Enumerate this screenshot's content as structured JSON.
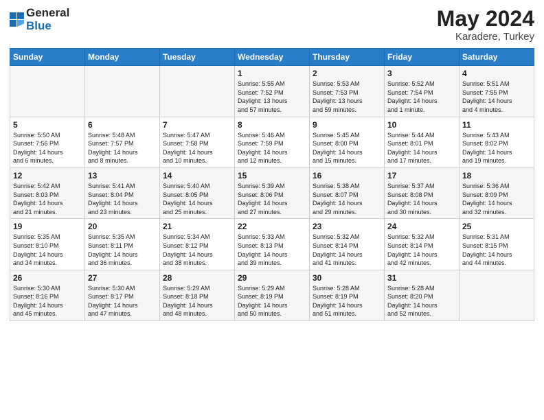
{
  "header": {
    "logo_line1": "General",
    "logo_line2": "Blue",
    "month": "May 2024",
    "location": "Karadere, Turkey"
  },
  "days_of_week": [
    "Sunday",
    "Monday",
    "Tuesday",
    "Wednesday",
    "Thursday",
    "Friday",
    "Saturday"
  ],
  "weeks": [
    [
      {
        "day": "",
        "info": ""
      },
      {
        "day": "",
        "info": ""
      },
      {
        "day": "",
        "info": ""
      },
      {
        "day": "1",
        "info": "Sunrise: 5:55 AM\nSunset: 7:52 PM\nDaylight: 13 hours\nand 57 minutes."
      },
      {
        "day": "2",
        "info": "Sunrise: 5:53 AM\nSunset: 7:53 PM\nDaylight: 13 hours\nand 59 minutes."
      },
      {
        "day": "3",
        "info": "Sunrise: 5:52 AM\nSunset: 7:54 PM\nDaylight: 14 hours\nand 1 minute."
      },
      {
        "day": "4",
        "info": "Sunrise: 5:51 AM\nSunset: 7:55 PM\nDaylight: 14 hours\nand 4 minutes."
      }
    ],
    [
      {
        "day": "5",
        "info": "Sunrise: 5:50 AM\nSunset: 7:56 PM\nDaylight: 14 hours\nand 6 minutes."
      },
      {
        "day": "6",
        "info": "Sunrise: 5:48 AM\nSunset: 7:57 PM\nDaylight: 14 hours\nand 8 minutes."
      },
      {
        "day": "7",
        "info": "Sunrise: 5:47 AM\nSunset: 7:58 PM\nDaylight: 14 hours\nand 10 minutes."
      },
      {
        "day": "8",
        "info": "Sunrise: 5:46 AM\nSunset: 7:59 PM\nDaylight: 14 hours\nand 12 minutes."
      },
      {
        "day": "9",
        "info": "Sunrise: 5:45 AM\nSunset: 8:00 PM\nDaylight: 14 hours\nand 15 minutes."
      },
      {
        "day": "10",
        "info": "Sunrise: 5:44 AM\nSunset: 8:01 PM\nDaylight: 14 hours\nand 17 minutes."
      },
      {
        "day": "11",
        "info": "Sunrise: 5:43 AM\nSunset: 8:02 PM\nDaylight: 14 hours\nand 19 minutes."
      }
    ],
    [
      {
        "day": "12",
        "info": "Sunrise: 5:42 AM\nSunset: 8:03 PM\nDaylight: 14 hours\nand 21 minutes."
      },
      {
        "day": "13",
        "info": "Sunrise: 5:41 AM\nSunset: 8:04 PM\nDaylight: 14 hours\nand 23 minutes."
      },
      {
        "day": "14",
        "info": "Sunrise: 5:40 AM\nSunset: 8:05 PM\nDaylight: 14 hours\nand 25 minutes."
      },
      {
        "day": "15",
        "info": "Sunrise: 5:39 AM\nSunset: 8:06 PM\nDaylight: 14 hours\nand 27 minutes."
      },
      {
        "day": "16",
        "info": "Sunrise: 5:38 AM\nSunset: 8:07 PM\nDaylight: 14 hours\nand 29 minutes."
      },
      {
        "day": "17",
        "info": "Sunrise: 5:37 AM\nSunset: 8:08 PM\nDaylight: 14 hours\nand 30 minutes."
      },
      {
        "day": "18",
        "info": "Sunrise: 5:36 AM\nSunset: 8:09 PM\nDaylight: 14 hours\nand 32 minutes."
      }
    ],
    [
      {
        "day": "19",
        "info": "Sunrise: 5:35 AM\nSunset: 8:10 PM\nDaylight: 14 hours\nand 34 minutes."
      },
      {
        "day": "20",
        "info": "Sunrise: 5:35 AM\nSunset: 8:11 PM\nDaylight: 14 hours\nand 36 minutes."
      },
      {
        "day": "21",
        "info": "Sunrise: 5:34 AM\nSunset: 8:12 PM\nDaylight: 14 hours\nand 38 minutes."
      },
      {
        "day": "22",
        "info": "Sunrise: 5:33 AM\nSunset: 8:13 PM\nDaylight: 14 hours\nand 39 minutes."
      },
      {
        "day": "23",
        "info": "Sunrise: 5:32 AM\nSunset: 8:14 PM\nDaylight: 14 hours\nand 41 minutes."
      },
      {
        "day": "24",
        "info": "Sunrise: 5:32 AM\nSunset: 8:14 PM\nDaylight: 14 hours\nand 42 minutes."
      },
      {
        "day": "25",
        "info": "Sunrise: 5:31 AM\nSunset: 8:15 PM\nDaylight: 14 hours\nand 44 minutes."
      }
    ],
    [
      {
        "day": "26",
        "info": "Sunrise: 5:30 AM\nSunset: 8:16 PM\nDaylight: 14 hours\nand 45 minutes."
      },
      {
        "day": "27",
        "info": "Sunrise: 5:30 AM\nSunset: 8:17 PM\nDaylight: 14 hours\nand 47 minutes."
      },
      {
        "day": "28",
        "info": "Sunrise: 5:29 AM\nSunset: 8:18 PM\nDaylight: 14 hours\nand 48 minutes."
      },
      {
        "day": "29",
        "info": "Sunrise: 5:29 AM\nSunset: 8:19 PM\nDaylight: 14 hours\nand 50 minutes."
      },
      {
        "day": "30",
        "info": "Sunrise: 5:28 AM\nSunset: 8:19 PM\nDaylight: 14 hours\nand 51 minutes."
      },
      {
        "day": "31",
        "info": "Sunrise: 5:28 AM\nSunset: 8:20 PM\nDaylight: 14 hours\nand 52 minutes."
      },
      {
        "day": "",
        "info": ""
      }
    ]
  ]
}
